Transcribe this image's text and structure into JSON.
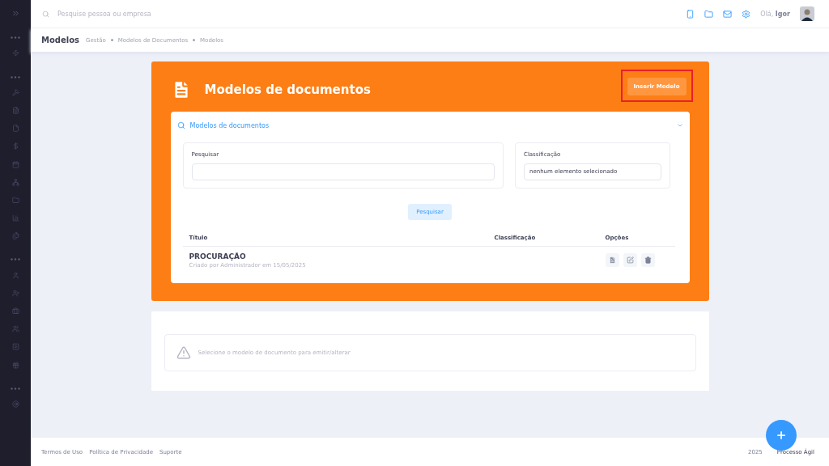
{
  "header": {
    "search": {
      "placeholder": "Pesquise pessoa ou empresa"
    },
    "greeting": "Olá,",
    "user": "Igor"
  },
  "breadcrumb": {
    "title": "Modelos",
    "items": [
      "Gestão",
      "Modelos de Documentos",
      "Modelos"
    ]
  },
  "panel": {
    "title": "Modelos de documentos",
    "insert_button": "Inserir Modelo",
    "highlighted": true,
    "filter": {
      "title": "Modelos de documentos",
      "expanded": true,
      "fields": [
        {
          "kind": "text",
          "label": "Pesquisar"
        },
        {
          "kind": "select",
          "label": "Classificação",
          "value": "nenhum elemento selecionado"
        }
      ],
      "button": "Pesquisar"
    },
    "table": {
      "columns": [
        "Título",
        "Classificação",
        "Opções"
      ],
      "rows": [
        {
          "title": "PROCURAÇÃO",
          "subtitle": "Criado por Administrador em 15/05/2025"
        }
      ]
    }
  },
  "notice": "Selecione o modelo de documento para emitir/alterar",
  "footer": {
    "links": [
      "Termos de Uso",
      "Política de Privacidade",
      "Suporte"
    ],
    "year": "2025",
    "brand": "Processo Ágil"
  }
}
